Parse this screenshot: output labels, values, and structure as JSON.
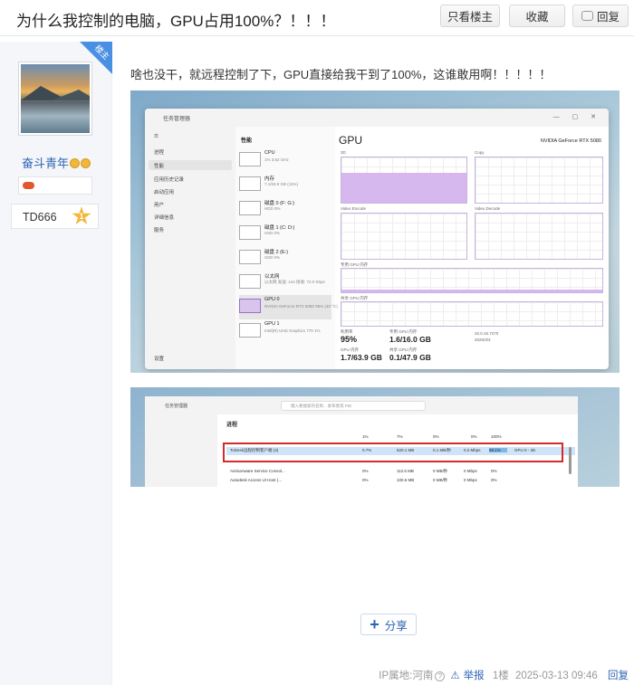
{
  "header": {
    "title": "为什么我控制的电脑，GPU占用100%？！！！",
    "btn_only_op": "只看楼主",
    "btn_favorite": "收藏",
    "btn_reply": "回复"
  },
  "author": {
    "username": "奋斗青年",
    "level_name": "TD666",
    "level_num": "1",
    "op_badge": "楼主"
  },
  "post": {
    "text": "啥也没干，就远程控制了下，GPU直接给我干到了100%，这谁敢用啊！！！！！"
  },
  "shot1": {
    "app_title": "任务管理器",
    "controls": "— ▢ ✕",
    "nav": [
      "☰",
      "进程",
      "性能",
      "应用历史记录",
      "启动应用",
      "用户",
      "详细信息",
      "服务",
      "设置"
    ],
    "section": "性能",
    "items": [
      {
        "name": "CPU",
        "sub": "1% 3.62 GHz"
      },
      {
        "name": "内存",
        "sub": "7.1/63.9 GB (11%)"
      },
      {
        "name": "磁盘 0 (F: G:)",
        "sub": "HDD 0%"
      },
      {
        "name": "磁盘 1 (C: D:)",
        "sub": "SSD 0%"
      },
      {
        "name": "磁盘 2 (E:)",
        "sub": "SSD 0%"
      },
      {
        "name": "以太网",
        "sub": "以太网 发送: 144 接收: 72.0 Kbps"
      },
      {
        "name": "GPU 0",
        "sub": "NVIDIA GeForce RTX 5080 95% (40 °C)"
      },
      {
        "name": "GPU 1",
        "sub": "Intel(R) UHD Graphics 770 1%"
      }
    ],
    "gpu_title": "GPU",
    "gpu_name": "NVIDIA GeForce RTX 5080",
    "graph_labels": {
      "g3d": "3D",
      "copy": "Copy",
      "venc": "Video Encode",
      "vdec": "Video Decode",
      "ded_mem": "专用 GPU 内存",
      "shared_mem": "共享 GPU 内存"
    },
    "stats": {
      "util_label": "利用率",
      "util": "95%",
      "ded_label": "专用 GPU 内存",
      "ded": "1.6/16.0 GB",
      "gpu_mem_label": "GPU 内存",
      "gpu_mem": "1.7/63.9 GB",
      "shared_label": "共享 GPU 内存",
      "shared": "0.1/47.9 GB",
      "driver": "32.0.15.7270",
      "date": "2025/3/3"
    }
  },
  "shot2": {
    "app_title": "任务管理器",
    "search_placeholder": "键入要搜索的名称、发布者或 PID",
    "section": "进程",
    "headers": [
      "1%",
      "7%",
      "0%",
      "0%",
      "100%"
    ],
    "rows": [
      {
        "name": "ToDesk远程控制客户端 (3)",
        "cpu": "0.7%",
        "mem": "520.1 MB",
        "disk": "0.1 MB/秒",
        "net": "0.2 Mbps",
        "gpu": "99.1%",
        "engine": "GPU 0 - 3D"
      },
      {
        "name": "AnimaAware Service Consol...",
        "cpu": "0%",
        "mem": "112.5 MB",
        "disk": "0 MB/秒",
        "net": "0 Mbps",
        "gpu": "0%",
        "engine": ""
      },
      {
        "name": "Autodesk Access UI Host (...",
        "cpu": "0%",
        "mem": "100.6 MB",
        "disk": "0 MB/秒",
        "net": "0 Mbps",
        "gpu": "0%",
        "engine": ""
      }
    ]
  },
  "share": {
    "label": "分享"
  },
  "footer": {
    "ip": "IP属地:河南",
    "report": "举报",
    "floor": "1楼",
    "time": "2025-03-13 09:46",
    "reply": "回复"
  }
}
